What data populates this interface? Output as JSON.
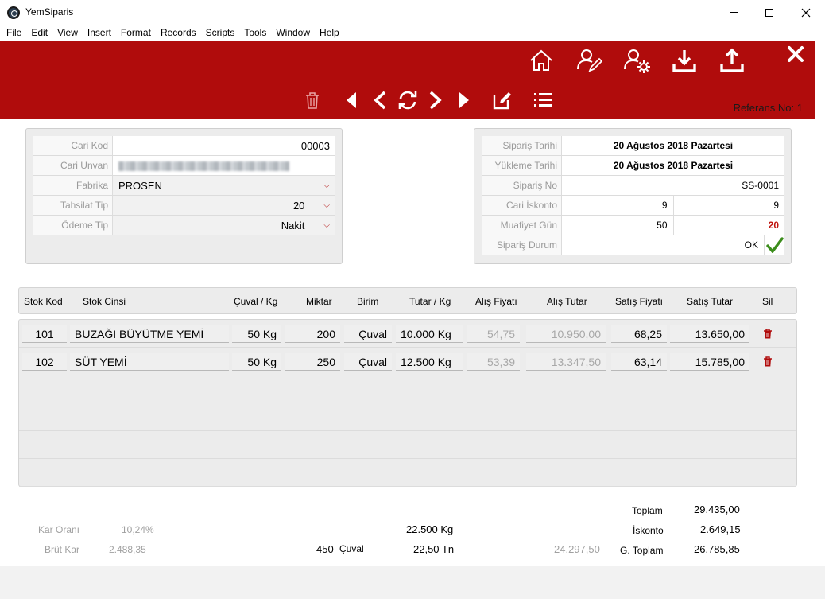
{
  "window": {
    "title": "YemSiparis"
  },
  "menu": [
    {
      "acc": "F",
      "rest": "ile"
    },
    {
      "acc": "E",
      "rest": "dit"
    },
    {
      "acc": "V",
      "rest": "iew"
    },
    {
      "acc": "I",
      "rest": "nsert"
    },
    {
      "acc": "F",
      "rest": "ormat"
    },
    {
      "acc": "R",
      "rest": "ecords"
    },
    {
      "acc": "S",
      "rest": "cripts"
    },
    {
      "acc": "T",
      "rest": "ools"
    },
    {
      "acc": "W",
      "rest": "indow"
    },
    {
      "acc": "H",
      "rest": "elp"
    }
  ],
  "toolbar": {
    "reference": "Referans No: 1"
  },
  "customer": {
    "cari_kod_label": "Cari Kod",
    "cari_kod": "00003",
    "cari_unvan_label": "Cari Unvan",
    "fabrika_label": "Fabrika",
    "fabrika": "PROSEN",
    "tahsilat_label": "Tahsilat Tip",
    "tahsilat": "20",
    "odeme_label": "Ödeme Tip",
    "odeme": "Nakit"
  },
  "order": {
    "siparis_tarihi_label": "Sipariş Tarihi",
    "siparis_tarihi": "20 Ağustos 2018 Pazartesi",
    "yukleme_tarihi_label": "Yükleme Tarihi",
    "yukleme_tarihi": "20 Ağustos 2018 Pazartesi",
    "siparis_no_label": "Sipariş No",
    "siparis_no": "SS-0001",
    "cari_iskonto_label": "Cari İskonto",
    "cari_iskonto_1": "9",
    "cari_iskonto_2": "9",
    "muafiyet_label": "Muafiyet Gün",
    "muafiyet_1": "50",
    "muafiyet_2": "20",
    "durum_label": "Sipariş Durum",
    "durum": "OK"
  },
  "grid": {
    "headers": {
      "stok_kod": "Stok Kod",
      "stok_cinsi": "Stok Cinsi",
      "cuval_kg": "Çuval / Kg",
      "miktar": "Miktar",
      "birim": "Birim",
      "tutar_kg": "Tutar / Kg",
      "alis_fiyati": "Alış Fiyatı",
      "alis_tutar": "Alış Tutar",
      "satis_fiyati": "Satış Fiyatı",
      "satis_tutar": "Satış Tutar",
      "sil": "Sil"
    },
    "rows": [
      {
        "kod": "101",
        "cins": "BUZAĞI BÜYÜTME YEMİ",
        "cuval_kg": "50 Kg",
        "miktar": "200",
        "birim": "Çuval",
        "tutar_kg": "10.000 Kg",
        "alis_fiyati": "54,75",
        "alis_tutar": "10.950,00",
        "satis_fiyati": "68,25",
        "satis_tutar": "13.650,00"
      },
      {
        "kod": "102",
        "cins": "SÜT YEMİ",
        "cuval_kg": "50 Kg",
        "miktar": "250",
        "birim": "Çuval",
        "tutar_kg": "12.500 Kg",
        "alis_fiyati": "53,39",
        "alis_tutar": "13.347,50",
        "satis_fiyati": "63,14",
        "satis_tutar": "15.785,00"
      }
    ]
  },
  "summary": {
    "kar_orani_label": "Kar Oranı",
    "kar_orani": "10,24%",
    "brut_kar_label": "Brüt Kar",
    "brut_kar": "2.488,35",
    "total_kg": "22.500 Kg",
    "total_cuval_count": "450",
    "total_cuval_unit": "Çuval",
    "total_tn": "22,50 Tn",
    "alis_total": "24.297,50",
    "toplam_label": "Toplam",
    "toplam": "29.435,00",
    "iskonto_label": "İskonto",
    "iskonto": "2.649,15",
    "gtoplam_label": "G. Toplam",
    "gtoplam": "26.785,85"
  },
  "colors": {
    "brand_red": "#b00c0c",
    "check_green": "#3c8d1c"
  },
  "icons": [
    "home-icon",
    "user-edit-icon",
    "user-settings-icon",
    "download-icon",
    "upload-icon",
    "close-icon",
    "trash-icon",
    "first-record-icon",
    "previous-record-icon",
    "refresh-icon",
    "next-record-icon",
    "last-record-icon",
    "edit-icon",
    "list-icon",
    "checkmark-icon",
    "chevron-down-icon"
  ]
}
